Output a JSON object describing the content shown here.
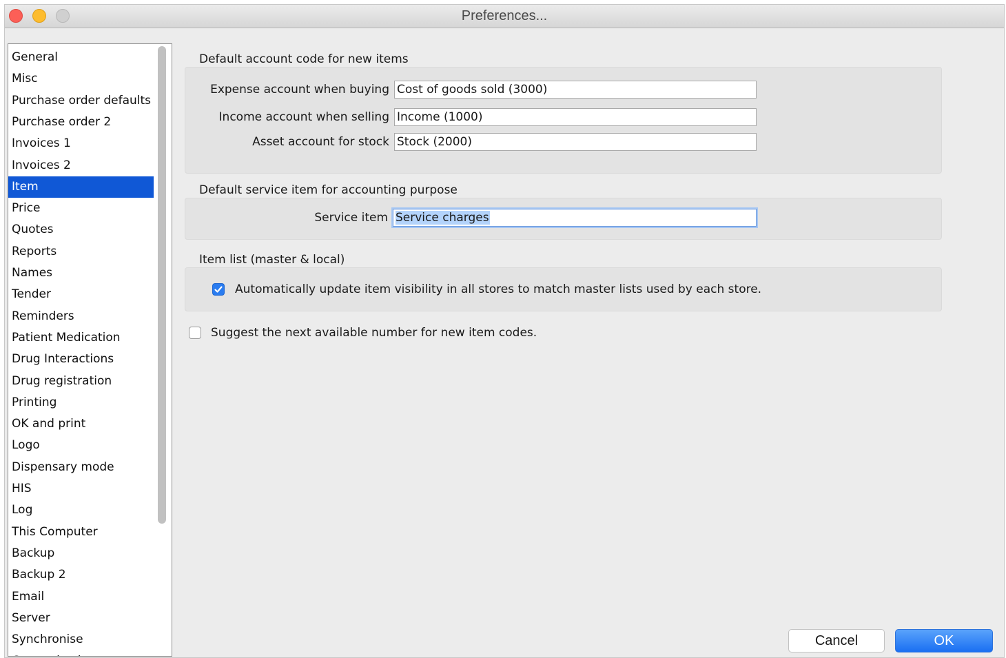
{
  "window": {
    "title": "Preferences..."
  },
  "sidebar": {
    "items": [
      {
        "label": "General"
      },
      {
        "label": "Misc"
      },
      {
        "label": "Purchase order defaults"
      },
      {
        "label": "Purchase order 2"
      },
      {
        "label": "Invoices 1"
      },
      {
        "label": "Invoices 2"
      },
      {
        "label": "Item",
        "selected": true
      },
      {
        "label": "Price"
      },
      {
        "label": "Quotes"
      },
      {
        "label": "Reports"
      },
      {
        "label": "Names"
      },
      {
        "label": "Tender"
      },
      {
        "label": "Reminders"
      },
      {
        "label": "Patient Medication"
      },
      {
        "label": "Drug Interactions"
      },
      {
        "label": "Drug registration"
      },
      {
        "label": "Printing"
      },
      {
        "label": "OK and print"
      },
      {
        "label": "Logo"
      },
      {
        "label": "Dispensary mode"
      },
      {
        "label": "HIS"
      },
      {
        "label": "Log"
      },
      {
        "label": "This Computer"
      },
      {
        "label": "Backup"
      },
      {
        "label": "Backup 2"
      },
      {
        "label": "Email"
      },
      {
        "label": "Server"
      },
      {
        "label": "Synchronise"
      },
      {
        "label": "Customisation"
      }
    ]
  },
  "accounts": {
    "heading": "Default account code for new items",
    "expense_label": "Expense account when buying",
    "expense_value": "Cost of goods sold (3000)",
    "income_label": "Income account when selling",
    "income_value": "Income (1000)",
    "asset_label": "Asset account for stock",
    "asset_value": "Stock (2000)"
  },
  "service": {
    "heading": "Default service item for accounting purpose",
    "label": "Service item",
    "value": "Service charges"
  },
  "item_list": {
    "heading": "Item list (master & local)",
    "auto_update_label": "Automatically update item visibility in all stores to match master lists used by each store.",
    "auto_update_checked": true
  },
  "suggest": {
    "label": "Suggest the next available number for new item codes.",
    "checked": false
  },
  "buttons": {
    "cancel": "Cancel",
    "ok": "OK"
  },
  "colors": {
    "accent": "#1058d6",
    "ok_button": "#1a6ff2",
    "checkbox_on": "#2a7cf0"
  }
}
